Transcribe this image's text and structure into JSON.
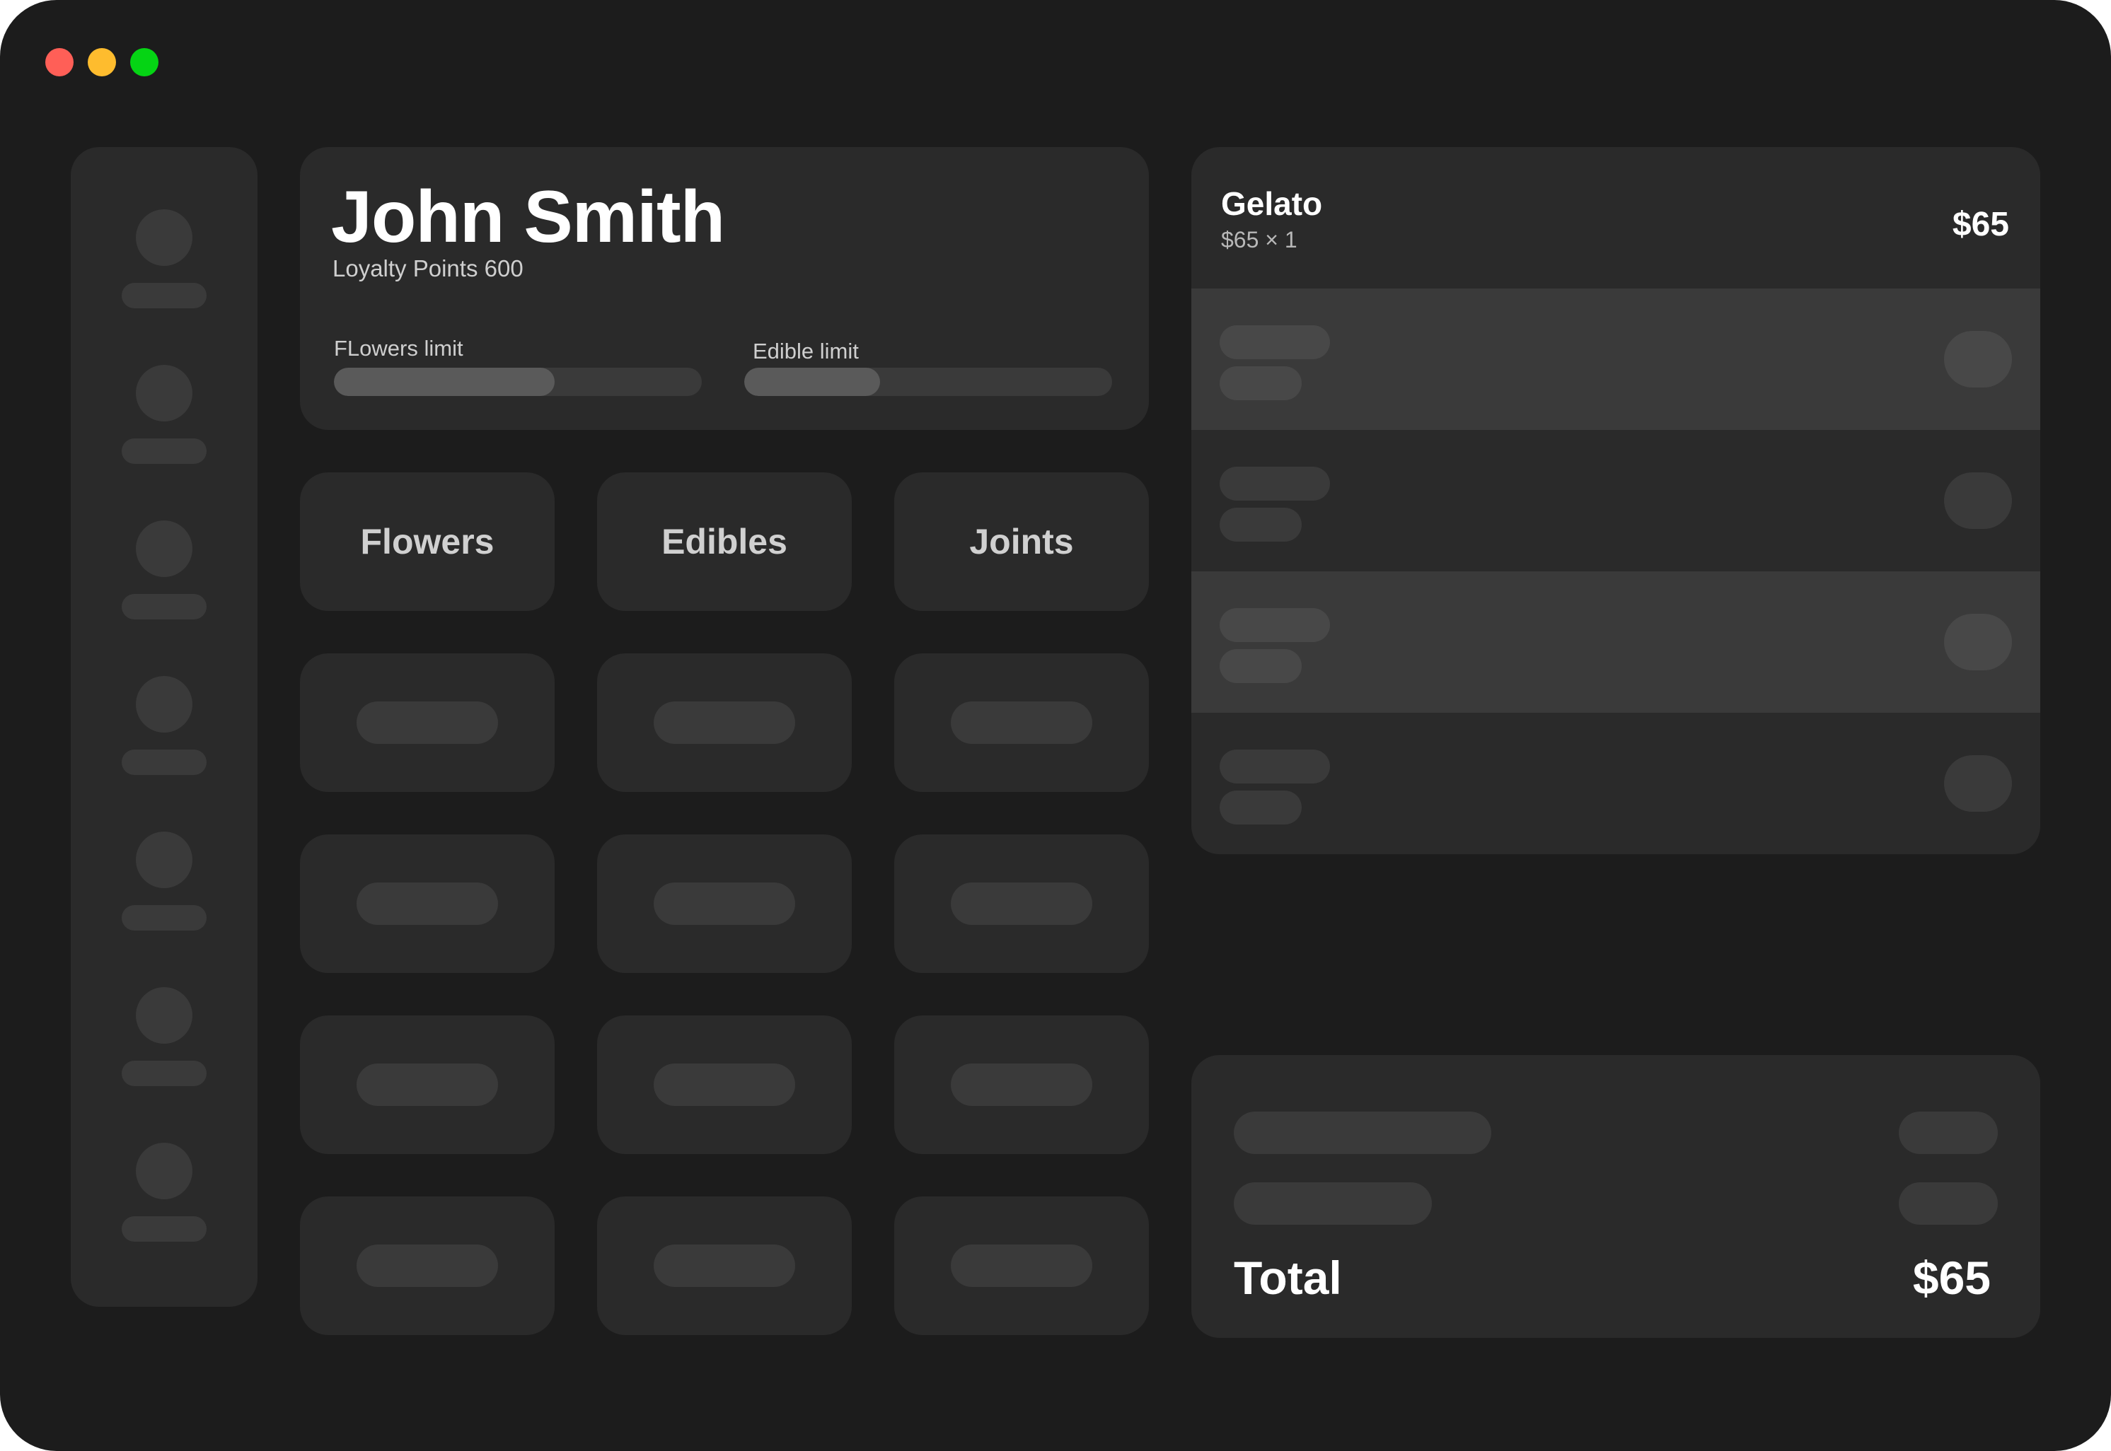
{
  "window": {
    "controls": [
      {
        "name": "close",
        "color": "#ff5f57"
      },
      {
        "name": "minimize",
        "color": "#febc2e"
      },
      {
        "name": "maximize",
        "color": "#05d414"
      }
    ]
  },
  "sidebar": {
    "item_count": 7
  },
  "customer": {
    "name": "John Smith",
    "loyalty": "Loyalty Points 600",
    "limits": [
      {
        "label": "FLowers limit",
        "progress": 0.6
      },
      {
        "label": "Edible limit",
        "progress": 0.37
      }
    ]
  },
  "categories": [
    {
      "label": "Flowers"
    },
    {
      "label": "Edibles"
    },
    {
      "label": "Joints"
    }
  ],
  "product_placeholder_rows": 4,
  "cart": {
    "item": {
      "name": "Gelato",
      "detail": "$65 × 1",
      "price": "$65"
    },
    "placeholder_rows": 4
  },
  "summary": {
    "total_label": "Total",
    "total_value": "$65"
  },
  "colors": {
    "window_bg": "#1c1c1c",
    "card_bg": "#2a2a2a",
    "placeholder": "#3a3a3a",
    "progress_fill": "#5a5a5a"
  }
}
